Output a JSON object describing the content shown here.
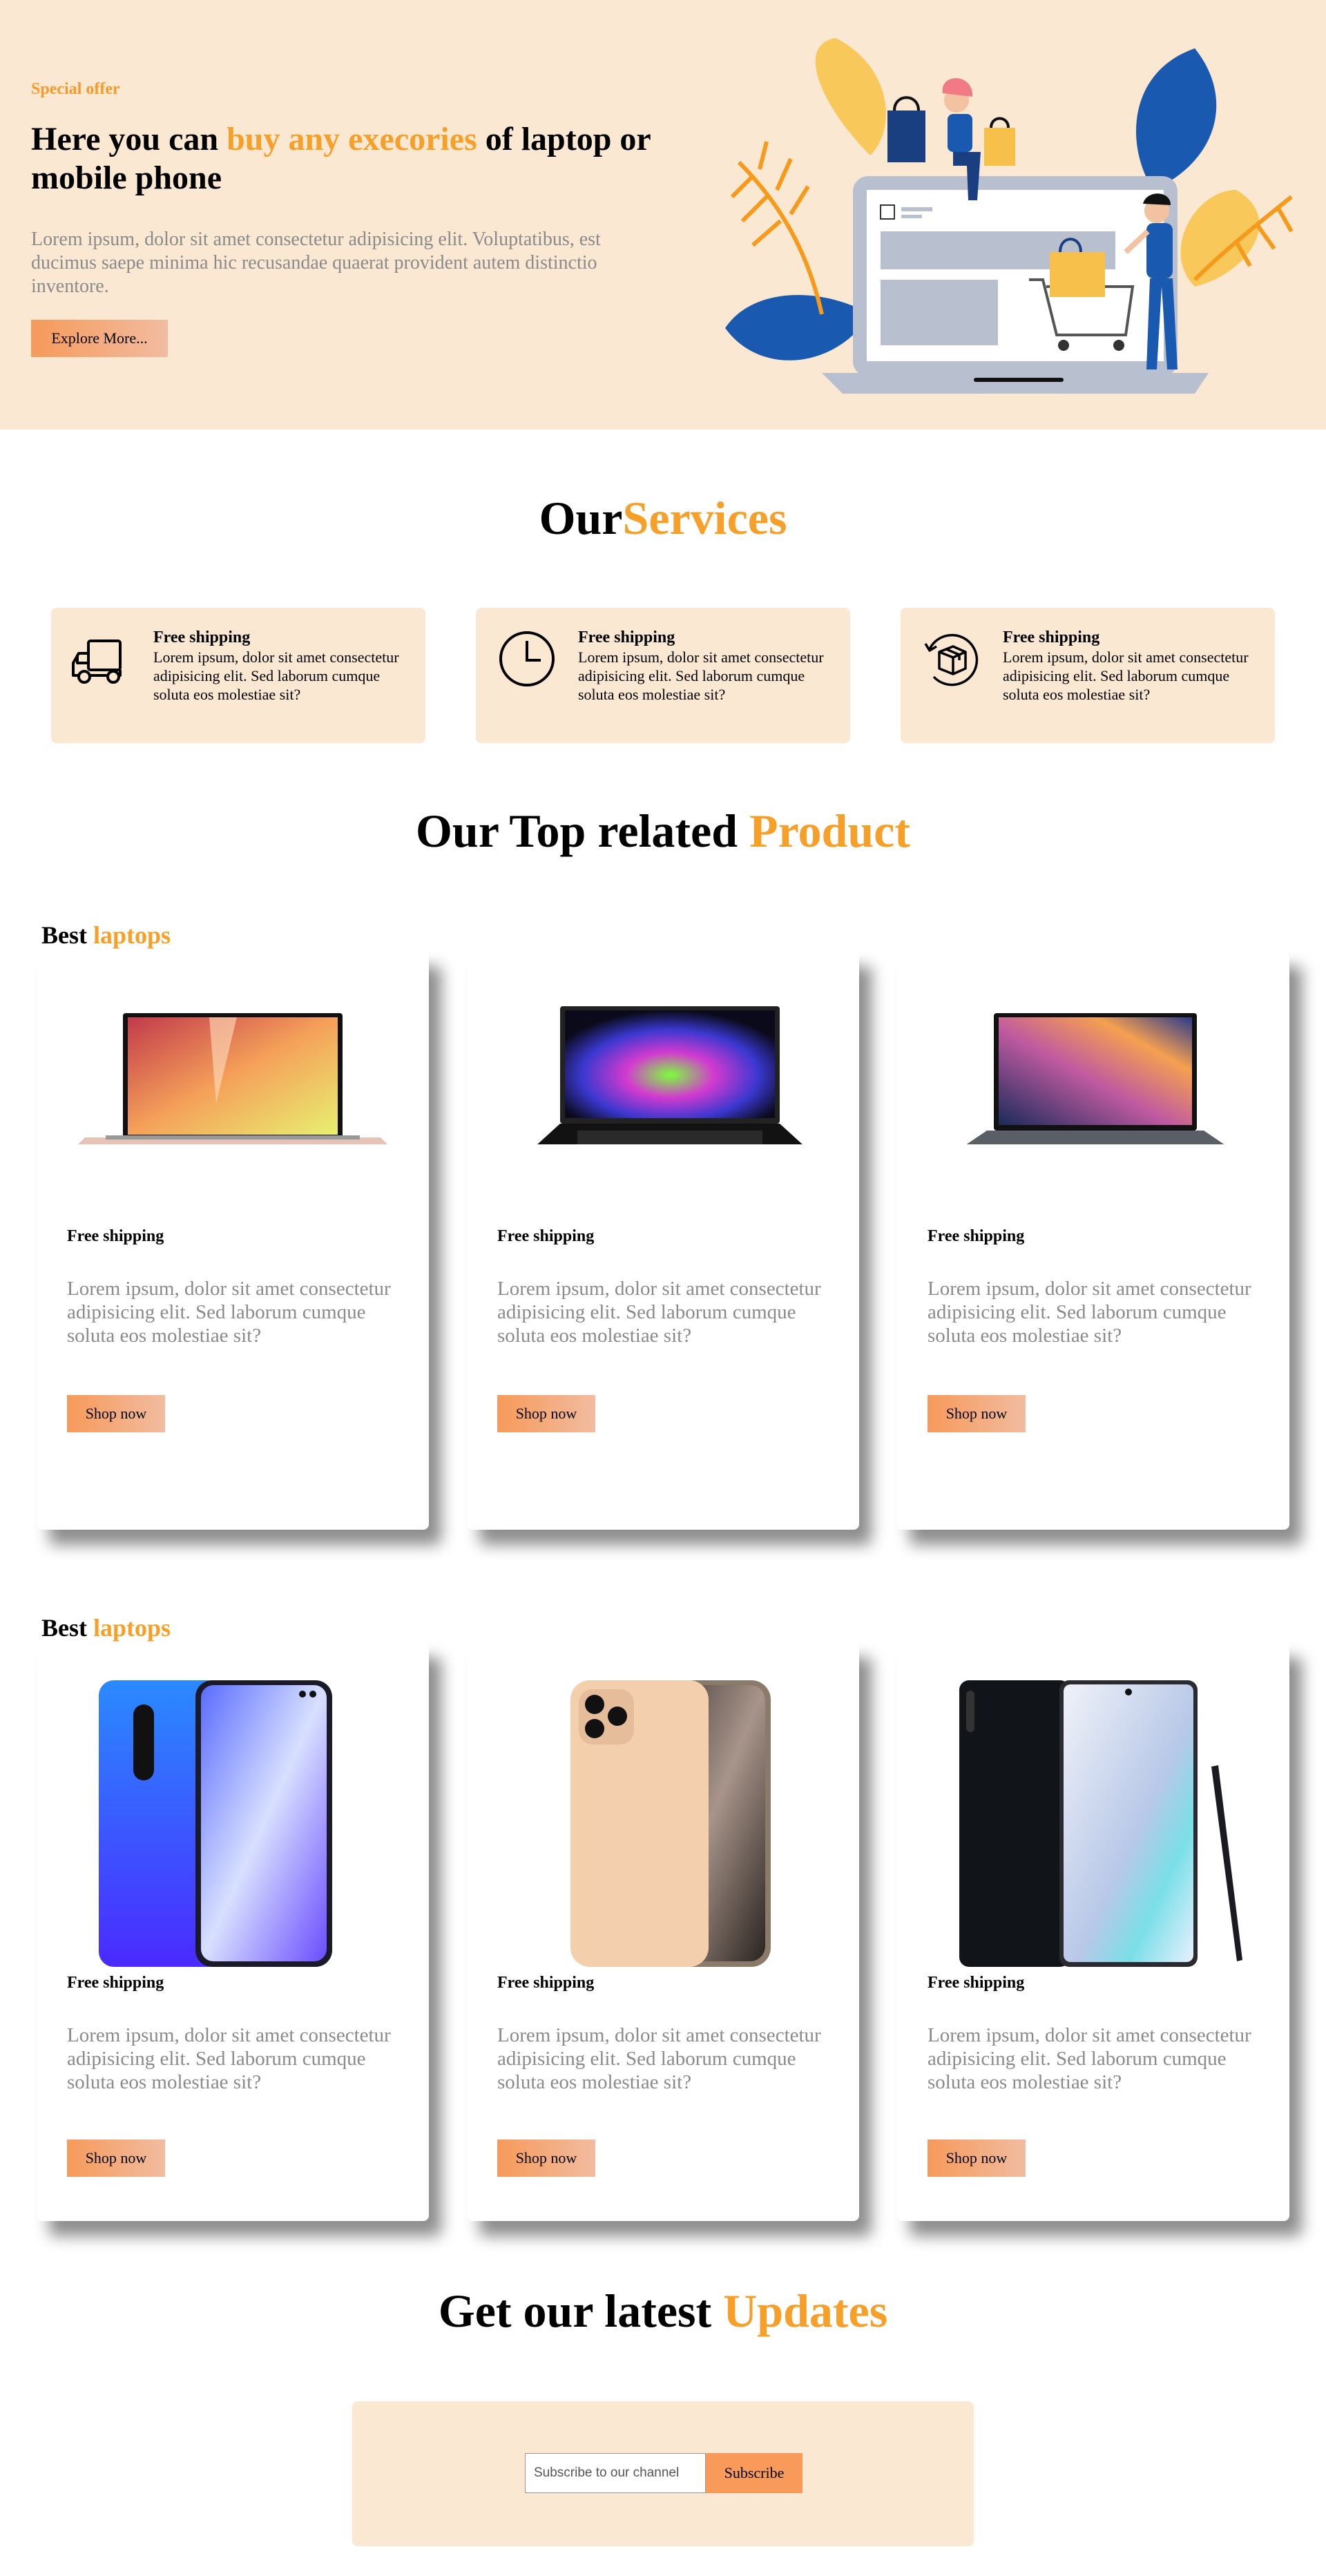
{
  "hero": {
    "eyebrow": "Special offer",
    "title_pre": "Here you can ",
    "title_accent": "buy any execories",
    "title_post": " of laptop or mobile phone",
    "text": "Lorem ipsum, dolor sit amet consectetur adipisicing elit. Voluptatibus, est ducimus saepe minima hic recusandae quaerat provident autem distinctio inventore.",
    "button": "Explore More..."
  },
  "services": {
    "title_pre": "Our",
    "title_accent": "Services",
    "items": [
      {
        "icon": "truck-icon",
        "title": "Free shipping",
        "text": "Lorem ipsum, dolor sit amet consectetur adipisicing elit. Sed laborum cumque soluta eos molestiae sit?"
      },
      {
        "icon": "clock-icon",
        "title": "Free shipping",
        "text": "Lorem ipsum, dolor sit amet consectetur adipisicing elit. Sed laborum cumque soluta eos molestiae sit?"
      },
      {
        "icon": "package-return-icon",
        "title": "Free shipping",
        "text": "Lorem ipsum, dolor sit amet consectetur adipisicing elit. Sed laborum cumque soluta eos molestiae sit?"
      }
    ]
  },
  "products": {
    "title_pre": "Our Top related ",
    "title_accent": "Product",
    "rows": [
      {
        "label_pre": "Best ",
        "label_accent": "laptops",
        "items": [
          {
            "image": "laptop-rose-gold",
            "title": "Free shipping",
            "text": "Lorem ipsum, dolor sit amet consectetur adipisicing elit. Sed laborum cumque soluta eos molestiae sit?",
            "button": "Shop now"
          },
          {
            "image": "laptop-gaming-black",
            "title": "Free shipping",
            "text": "Lorem ipsum, dolor sit amet consectetur adipisicing elit. Sed laborum cumque soluta eos molestiae sit?",
            "button": "Shop now"
          },
          {
            "image": "laptop-space-gray",
            "title": "Free shipping",
            "text": "Lorem ipsum, dolor sit amet consectetur adipisicing elit. Sed laborum cumque soluta eos molestiae sit?",
            "button": "Shop now"
          }
        ]
      },
      {
        "label_pre": "Best ",
        "label_accent": "laptops",
        "items": [
          {
            "image": "phone-blue",
            "title": "Free shipping",
            "text": "Lorem ipsum, dolor sit amet consectetur adipisicing elit. Sed laborum cumque soluta eos molestiae sit?",
            "button": "Shop now"
          },
          {
            "image": "phone-gold",
            "title": "Free shipping",
            "text": "Lorem ipsum, dolor sit amet consectetur adipisicing elit. Sed laborum cumque soluta eos molestiae sit?",
            "button": "Shop now"
          },
          {
            "image": "phone-black-stylus",
            "title": "Free shipping",
            "text": "Lorem ipsum, dolor sit amet consectetur adipisicing elit. Sed laborum cumque soluta eos molestiae sit?",
            "button": "Shop now"
          }
        ]
      }
    ]
  },
  "updates": {
    "title_pre": "Get our latest ",
    "title_accent": "Updates",
    "input_placeholder": "Subscribe to our channel",
    "button": "Subscribe"
  },
  "colors": {
    "accent": "#f6a02a",
    "cream": "#fbe8d2",
    "button_start": "#f79a5a",
    "button_end": "#f1bca0"
  }
}
